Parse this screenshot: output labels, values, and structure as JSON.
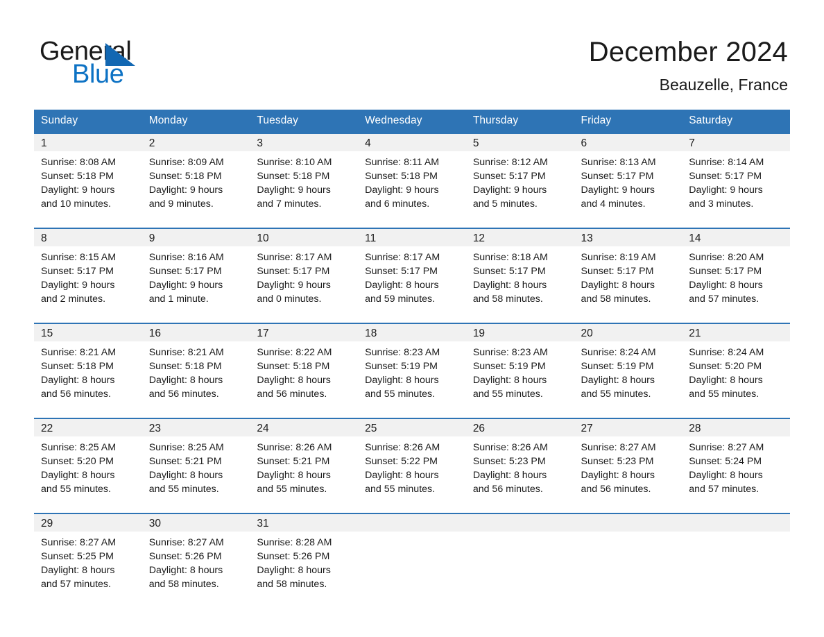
{
  "brand": {
    "name_part1": "General",
    "name_part2": "Blue",
    "logo_color": "#0d72c4",
    "triangle_color": "#1267b2"
  },
  "header": {
    "title": "December 2024",
    "subtitle": "Beauzelle, France"
  },
  "theme": {
    "header_blue": "#2e74b5",
    "row_band_gray": "#f1f1f1",
    "text": "#1a1a1a"
  },
  "weekday_headers": [
    "Sunday",
    "Monday",
    "Tuesday",
    "Wednesday",
    "Thursday",
    "Friday",
    "Saturday"
  ],
  "weeks": [
    [
      {
        "day": "1",
        "sunrise": "Sunrise: 8:08 AM",
        "sunset": "Sunset: 5:18 PM",
        "daylight_1": "Daylight: 9 hours",
        "daylight_2": "and 10 minutes."
      },
      {
        "day": "2",
        "sunrise": "Sunrise: 8:09 AM",
        "sunset": "Sunset: 5:18 PM",
        "daylight_1": "Daylight: 9 hours",
        "daylight_2": "and 9 minutes."
      },
      {
        "day": "3",
        "sunrise": "Sunrise: 8:10 AM",
        "sunset": "Sunset: 5:18 PM",
        "daylight_1": "Daylight: 9 hours",
        "daylight_2": "and 7 minutes."
      },
      {
        "day": "4",
        "sunrise": "Sunrise: 8:11 AM",
        "sunset": "Sunset: 5:18 PM",
        "daylight_1": "Daylight: 9 hours",
        "daylight_2": "and 6 minutes."
      },
      {
        "day": "5",
        "sunrise": "Sunrise: 8:12 AM",
        "sunset": "Sunset: 5:17 PM",
        "daylight_1": "Daylight: 9 hours",
        "daylight_2": "and 5 minutes."
      },
      {
        "day": "6",
        "sunrise": "Sunrise: 8:13 AM",
        "sunset": "Sunset: 5:17 PM",
        "daylight_1": "Daylight: 9 hours",
        "daylight_2": "and 4 minutes."
      },
      {
        "day": "7",
        "sunrise": "Sunrise: 8:14 AM",
        "sunset": "Sunset: 5:17 PM",
        "daylight_1": "Daylight: 9 hours",
        "daylight_2": "and 3 minutes."
      }
    ],
    [
      {
        "day": "8",
        "sunrise": "Sunrise: 8:15 AM",
        "sunset": "Sunset: 5:17 PM",
        "daylight_1": "Daylight: 9 hours",
        "daylight_2": "and 2 minutes."
      },
      {
        "day": "9",
        "sunrise": "Sunrise: 8:16 AM",
        "sunset": "Sunset: 5:17 PM",
        "daylight_1": "Daylight: 9 hours",
        "daylight_2": "and 1 minute."
      },
      {
        "day": "10",
        "sunrise": "Sunrise: 8:17 AM",
        "sunset": "Sunset: 5:17 PM",
        "daylight_1": "Daylight: 9 hours",
        "daylight_2": "and 0 minutes."
      },
      {
        "day": "11",
        "sunrise": "Sunrise: 8:17 AM",
        "sunset": "Sunset: 5:17 PM",
        "daylight_1": "Daylight: 8 hours",
        "daylight_2": "and 59 minutes."
      },
      {
        "day": "12",
        "sunrise": "Sunrise: 8:18 AM",
        "sunset": "Sunset: 5:17 PM",
        "daylight_1": "Daylight: 8 hours",
        "daylight_2": "and 58 minutes."
      },
      {
        "day": "13",
        "sunrise": "Sunrise: 8:19 AM",
        "sunset": "Sunset: 5:17 PM",
        "daylight_1": "Daylight: 8 hours",
        "daylight_2": "and 58 minutes."
      },
      {
        "day": "14",
        "sunrise": "Sunrise: 8:20 AM",
        "sunset": "Sunset: 5:17 PM",
        "daylight_1": "Daylight: 8 hours",
        "daylight_2": "and 57 minutes."
      }
    ],
    [
      {
        "day": "15",
        "sunrise": "Sunrise: 8:21 AM",
        "sunset": "Sunset: 5:18 PM",
        "daylight_1": "Daylight: 8 hours",
        "daylight_2": "and 56 minutes."
      },
      {
        "day": "16",
        "sunrise": "Sunrise: 8:21 AM",
        "sunset": "Sunset: 5:18 PM",
        "daylight_1": "Daylight: 8 hours",
        "daylight_2": "and 56 minutes."
      },
      {
        "day": "17",
        "sunrise": "Sunrise: 8:22 AM",
        "sunset": "Sunset: 5:18 PM",
        "daylight_1": "Daylight: 8 hours",
        "daylight_2": "and 56 minutes."
      },
      {
        "day": "18",
        "sunrise": "Sunrise: 8:23 AM",
        "sunset": "Sunset: 5:19 PM",
        "daylight_1": "Daylight: 8 hours",
        "daylight_2": "and 55 minutes."
      },
      {
        "day": "19",
        "sunrise": "Sunrise: 8:23 AM",
        "sunset": "Sunset: 5:19 PM",
        "daylight_1": "Daylight: 8 hours",
        "daylight_2": "and 55 minutes."
      },
      {
        "day": "20",
        "sunrise": "Sunrise: 8:24 AM",
        "sunset": "Sunset: 5:19 PM",
        "daylight_1": "Daylight: 8 hours",
        "daylight_2": "and 55 minutes."
      },
      {
        "day": "21",
        "sunrise": "Sunrise: 8:24 AM",
        "sunset": "Sunset: 5:20 PM",
        "daylight_1": "Daylight: 8 hours",
        "daylight_2": "and 55 minutes."
      }
    ],
    [
      {
        "day": "22",
        "sunrise": "Sunrise: 8:25 AM",
        "sunset": "Sunset: 5:20 PM",
        "daylight_1": "Daylight: 8 hours",
        "daylight_2": "and 55 minutes."
      },
      {
        "day": "23",
        "sunrise": "Sunrise: 8:25 AM",
        "sunset": "Sunset: 5:21 PM",
        "daylight_1": "Daylight: 8 hours",
        "daylight_2": "and 55 minutes."
      },
      {
        "day": "24",
        "sunrise": "Sunrise: 8:26 AM",
        "sunset": "Sunset: 5:21 PM",
        "daylight_1": "Daylight: 8 hours",
        "daylight_2": "and 55 minutes."
      },
      {
        "day": "25",
        "sunrise": "Sunrise: 8:26 AM",
        "sunset": "Sunset: 5:22 PM",
        "daylight_1": "Daylight: 8 hours",
        "daylight_2": "and 55 minutes."
      },
      {
        "day": "26",
        "sunrise": "Sunrise: 8:26 AM",
        "sunset": "Sunset: 5:23 PM",
        "daylight_1": "Daylight: 8 hours",
        "daylight_2": "and 56 minutes."
      },
      {
        "day": "27",
        "sunrise": "Sunrise: 8:27 AM",
        "sunset": "Sunset: 5:23 PM",
        "daylight_1": "Daylight: 8 hours",
        "daylight_2": "and 56 minutes."
      },
      {
        "day": "28",
        "sunrise": "Sunrise: 8:27 AM",
        "sunset": "Sunset: 5:24 PM",
        "daylight_1": "Daylight: 8 hours",
        "daylight_2": "and 57 minutes."
      }
    ],
    [
      {
        "day": "29",
        "sunrise": "Sunrise: 8:27 AM",
        "sunset": "Sunset: 5:25 PM",
        "daylight_1": "Daylight: 8 hours",
        "daylight_2": "and 57 minutes."
      },
      {
        "day": "30",
        "sunrise": "Sunrise: 8:27 AM",
        "sunset": "Sunset: 5:26 PM",
        "daylight_1": "Daylight: 8 hours",
        "daylight_2": "and 58 minutes."
      },
      {
        "day": "31",
        "sunrise": "Sunrise: 8:28 AM",
        "sunset": "Sunset: 5:26 PM",
        "daylight_1": "Daylight: 8 hours",
        "daylight_2": "and 58 minutes."
      },
      {
        "day": "",
        "sunrise": "",
        "sunset": "",
        "daylight_1": "",
        "daylight_2": ""
      },
      {
        "day": "",
        "sunrise": "",
        "sunset": "",
        "daylight_1": "",
        "daylight_2": ""
      },
      {
        "day": "",
        "sunrise": "",
        "sunset": "",
        "daylight_1": "",
        "daylight_2": ""
      },
      {
        "day": "",
        "sunrise": "",
        "sunset": "",
        "daylight_1": "",
        "daylight_2": ""
      }
    ]
  ]
}
